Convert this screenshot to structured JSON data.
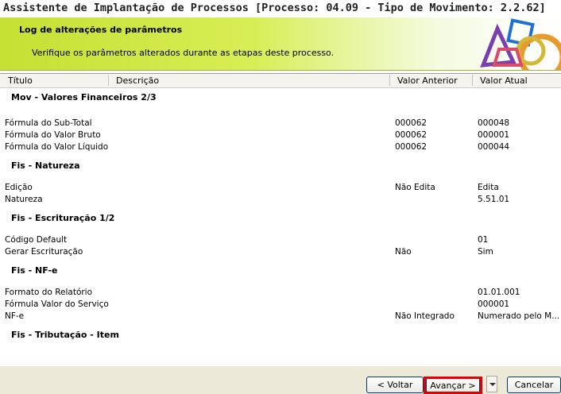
{
  "window": {
    "title": "Assistente de Implantação de Processos [Processo: 04.09 - Tipo de Movimento: 2.2.62]"
  },
  "banner": {
    "heading": "Log de alterações de parâmetros",
    "subtitle": "Verifique os parâmetros alterados durante as etapas deste processo."
  },
  "grid": {
    "columns": {
      "titulo": "Título",
      "descricao": "Descrição",
      "anterior": "Valor Anterior",
      "atual": "Valor Atual"
    },
    "groups": [
      {
        "name": "Mov - Valores Financeiros 2/3",
        "rows": [
          {
            "titulo": "Fórmula do Sub-Total",
            "anterior": "000062",
            "atual": "000048"
          },
          {
            "titulo": "Fórmula do Valor Bruto",
            "anterior": "000062",
            "atual": "000001"
          },
          {
            "titulo": "Fórmula do Valor Líquido",
            "anterior": "000062",
            "atual": "000044"
          }
        ]
      },
      {
        "name": "Fis - Natureza",
        "rows": [
          {
            "titulo": "Edição",
            "anterior": "Não Edita",
            "atual": "Edita"
          },
          {
            "titulo": "Natureza",
            "anterior": "",
            "atual": "5.51.01"
          }
        ]
      },
      {
        "name": "Fis - Escrituração 1/2",
        "rows": [
          {
            "titulo": "Código Default",
            "anterior": "",
            "atual": "01"
          },
          {
            "titulo": "Gerar Escrituração",
            "anterior": "Não",
            "atual": "Sim"
          }
        ]
      },
      {
        "name": "Fis - NF-e",
        "rows": [
          {
            "titulo": "Formato do Relatório",
            "anterior": "",
            "atual": "01.01.001"
          },
          {
            "titulo": "Fórmula Valor do Serviço",
            "anterior": "",
            "atual": "000001"
          },
          {
            "titulo": "NF-e",
            "anterior": "Não Integrado",
            "atual": "Numerado pelo M..."
          }
        ]
      },
      {
        "name": "Fis - Tributação - Item",
        "rows": []
      }
    ]
  },
  "buttons": {
    "back": "< Voltar",
    "next": "Avançar >",
    "cancel": "Cancelar"
  },
  "colors": {
    "banner": "#c6e033",
    "highlight": "#e00000"
  }
}
